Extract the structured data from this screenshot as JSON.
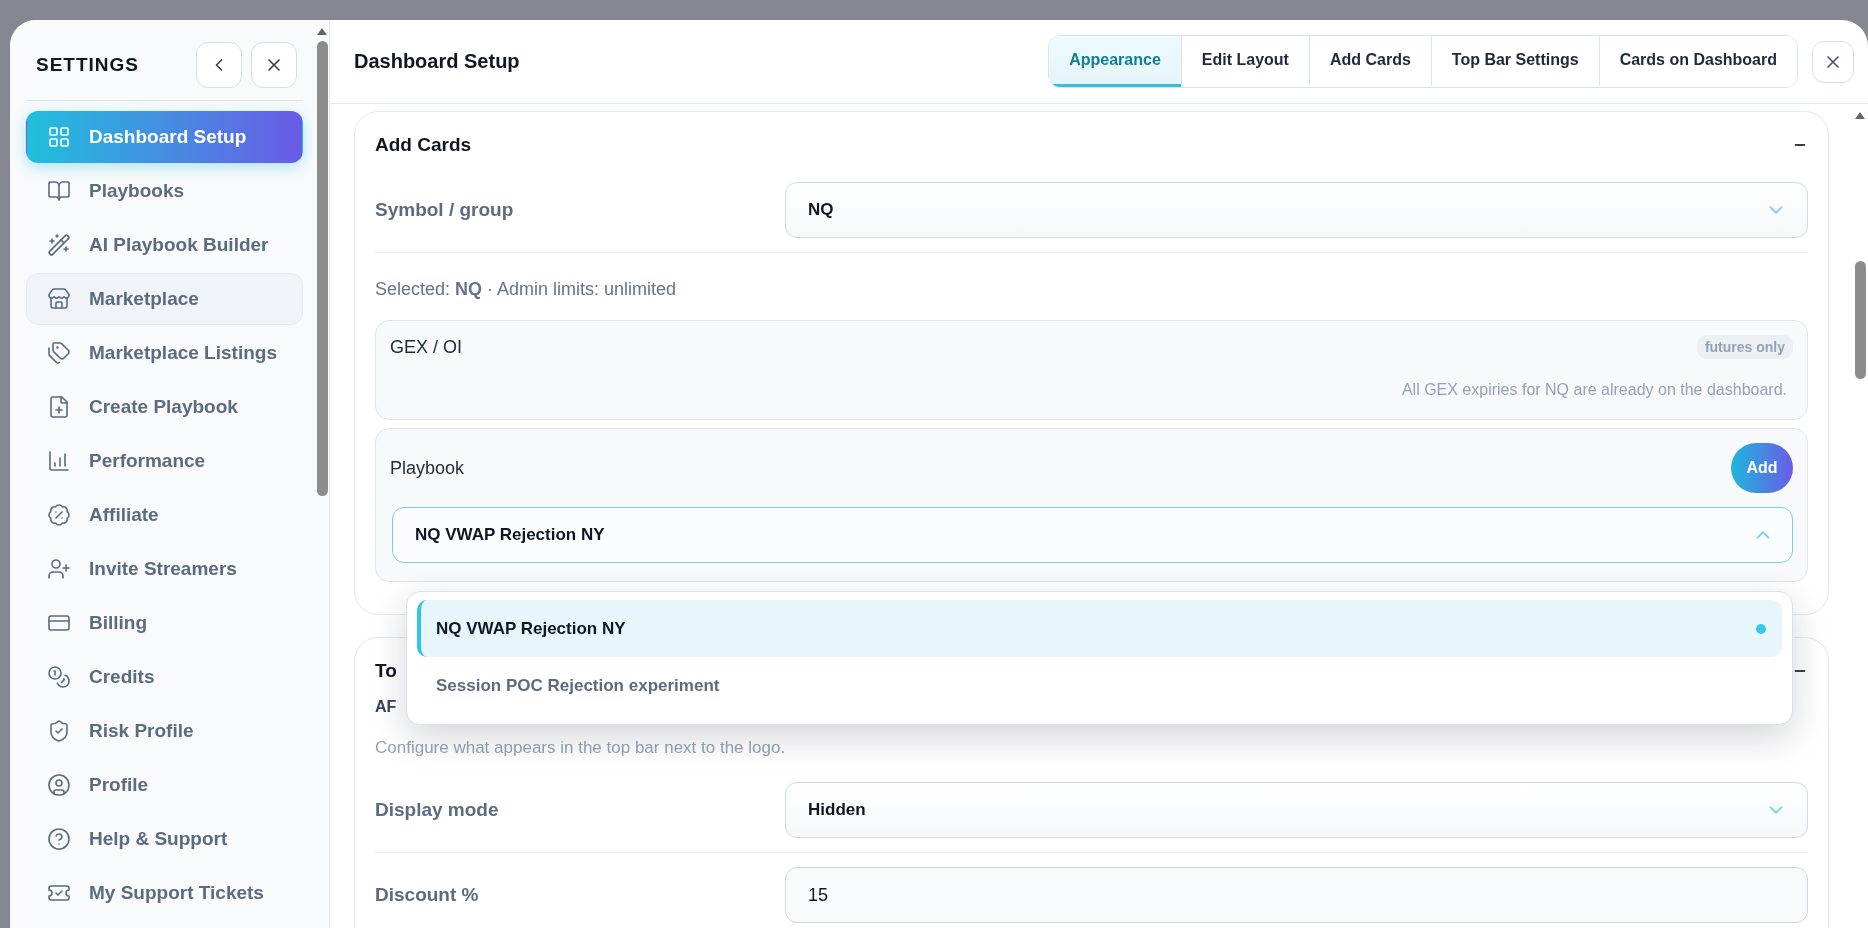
{
  "sidebar": {
    "title": "SETTINGS",
    "items": [
      {
        "label": "Dashboard Setup",
        "selected": true,
        "highlighted": false
      },
      {
        "label": "Playbooks",
        "selected": false,
        "highlighted": false
      },
      {
        "label": "AI Playbook Builder",
        "selected": false,
        "highlighted": false
      },
      {
        "label": "Marketplace",
        "selected": false,
        "highlighted": true
      },
      {
        "label": "Marketplace Listings",
        "selected": false,
        "highlighted": false
      },
      {
        "label": "Create Playbook",
        "selected": false,
        "highlighted": false
      },
      {
        "label": "Performance",
        "selected": false,
        "highlighted": false
      },
      {
        "label": "Affiliate",
        "selected": false,
        "highlighted": false
      },
      {
        "label": "Invite Streamers",
        "selected": false,
        "highlighted": false
      },
      {
        "label": "Billing",
        "selected": false,
        "highlighted": false
      },
      {
        "label": "Credits",
        "selected": false,
        "highlighted": false
      },
      {
        "label": "Risk Profile",
        "selected": false,
        "highlighted": false
      },
      {
        "label": "Profile",
        "selected": false,
        "highlighted": false
      },
      {
        "label": "Help & Support",
        "selected": false,
        "highlighted": false
      },
      {
        "label": "My Support Tickets",
        "selected": false,
        "highlighted": false
      }
    ]
  },
  "header": {
    "title": "Dashboard Setup",
    "tabs": [
      {
        "label": "Appearance",
        "selected": true
      },
      {
        "label": "Edit Layout",
        "selected": false
      },
      {
        "label": "Add Cards",
        "selected": false
      },
      {
        "label": "Top Bar Settings",
        "selected": false
      },
      {
        "label": "Cards on Dashboard",
        "selected": false
      }
    ]
  },
  "add_cards": {
    "title": "Add Cards",
    "symbol_field": {
      "label": "Symbol / group",
      "value": "NQ"
    },
    "selection_info": "Selected: **NQ** · Admin limits: unlimited",
    "gex": {
      "title": "GEX / OI",
      "badge": "futures only",
      "note": "All GEX expiries for NQ are already on the dashboard."
    },
    "playbook": {
      "label": "Playbook",
      "add_button": "Add",
      "value": "NQ VWAP Rejection NY",
      "expanded": true,
      "options": [
        {
          "label": "NQ VWAP Rejection NY",
          "selected": true
        },
        {
          "label": "Session POC Rejection experiment",
          "selected": false
        }
      ]
    }
  },
  "top_bar": {
    "title": "To",
    "subtitle": "AF",
    "description": "Configure what appears in the top bar next to the logo.",
    "fields": [
      {
        "kind": "select",
        "label": "Display mode",
        "value": "Hidden"
      },
      {
        "kind": "input",
        "label": "Discount %",
        "value": "15"
      }
    ]
  }
}
